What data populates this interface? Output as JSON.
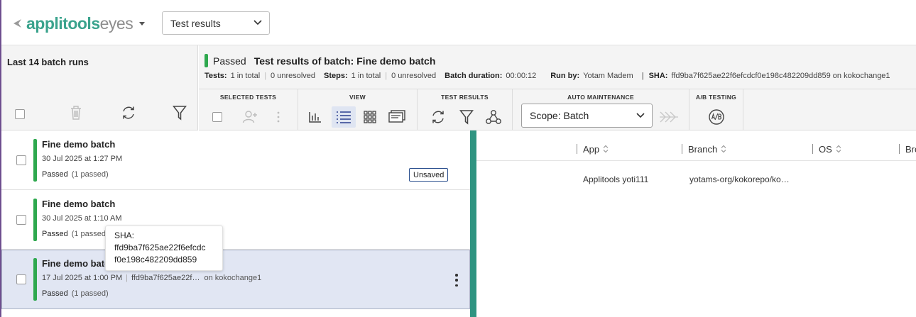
{
  "header": {
    "logo_bold": "applitools",
    "logo_light": "eyes",
    "view_select": "Test results"
  },
  "left_panel": {
    "title": "Last 14 batch runs"
  },
  "batch_summary": {
    "status": "Passed",
    "title": "Test results of batch:  Fine demo batch",
    "tests_label": "Tests:",
    "tests_total": "1 in total",
    "tests_unresolved": "0 unresolved",
    "steps_label": "Steps:",
    "steps_total": "1 in total",
    "steps_unresolved": "0 unresolved",
    "duration_label": "Batch duration:",
    "duration": "00:00:12",
    "runby_label": "Run by:",
    "runby": "Yotam Madem",
    "sha_label": "SHA:",
    "sha": "ffd9ba7f625ae22f6efcdcf0e198c482209dd859 on kokochange1",
    "sha_sep": "|"
  },
  "toolbar": {
    "selected_tests": "SELECTED TESTS",
    "view": "VIEW",
    "test_results": "TEST RESULTS",
    "auto_maintenance": "AUTO MAINTENANCE",
    "ab_testing": "A/B TESTING",
    "scope": "Scope: Batch"
  },
  "batches": [
    {
      "name": "Fine demo batch",
      "date": "30 Jul 2025 at 1:27 PM",
      "sha": "",
      "branch": "",
      "status": "Passed",
      "count": "(1 passed)",
      "badge": "Unsaved"
    },
    {
      "name": "Fine demo batch",
      "date": "30 Jul 2025 at 1:10 AM",
      "sha": "",
      "branch": "",
      "status": "Passed",
      "count": "(1 passed)",
      "badge": ""
    },
    {
      "name": "Fine demo batc",
      "date": "17 Jul 2025 at 1:00 PM",
      "sha": "ffd9ba7f625ae22f…",
      "branch": "on kokochange1",
      "status": "Passed",
      "count": "(1 passed)",
      "badge": ""
    }
  ],
  "tooltip": {
    "label": "SHA:",
    "line1": "ffd9ba7f625ae22f6efcdc",
    "line2": "f0e198c482209dd859"
  },
  "grid": {
    "columns": [
      "App",
      "Branch",
      "OS",
      "Bro"
    ],
    "row": {
      "app": "Applitools yoti111",
      "branch": "yotams-org/kokorepo/ko…"
    }
  },
  "colors": {
    "pass_green": "#2ea84e",
    "divider_teal": "#2f9481",
    "brand": "#3aa38d",
    "selected_row": "#e1e6f3"
  }
}
